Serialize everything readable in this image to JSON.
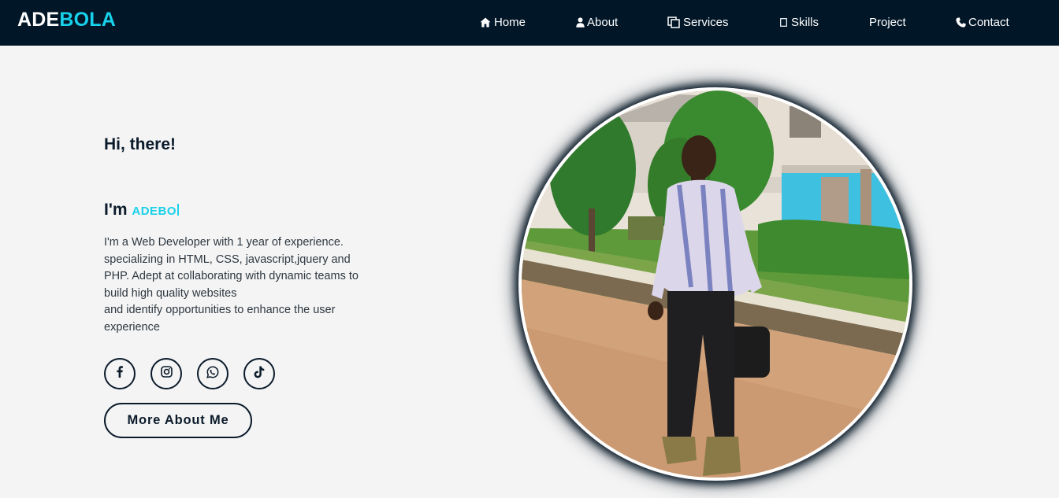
{
  "brand": {
    "part1": "ADE",
    "part2": "BOLA"
  },
  "nav": {
    "items": [
      {
        "label": "Home",
        "icon": "home-icon"
      },
      {
        "label": "About",
        "icon": "user-icon"
      },
      {
        "label": "Services",
        "icon": "copy-icon"
      },
      {
        "label": "Skills",
        "icon": "square-icon"
      },
      {
        "label": "Project",
        "icon": ""
      },
      {
        "label": "Contact",
        "icon": "phone-icon"
      }
    ]
  },
  "hero": {
    "greeting": "Hi, there!",
    "im_prefix": "I'm",
    "typed_name": "ADEBO",
    "bio_lines": [
      "I'm a Web Developer with 1 year of experience.",
      "specializing in HTML, CSS, javascript,jquery and",
      "PHP. Adept at collaborating with dynamic teams to",
      "build high quality websites",
      "and identify opportunities to enhance the user",
      "experience"
    ],
    "socials": [
      {
        "icon": "facebook-icon"
      },
      {
        "icon": "instagram-icon"
      },
      {
        "icon": "whatsapp-icon"
      },
      {
        "icon": "tiktok-icon"
      }
    ],
    "cta_label": "More About Me"
  },
  "colors": {
    "navbar_bg": "#011627",
    "accent": "#18d1ea",
    "text_dark": "#0b1b2b",
    "page_bg": "#f4f4f4"
  }
}
